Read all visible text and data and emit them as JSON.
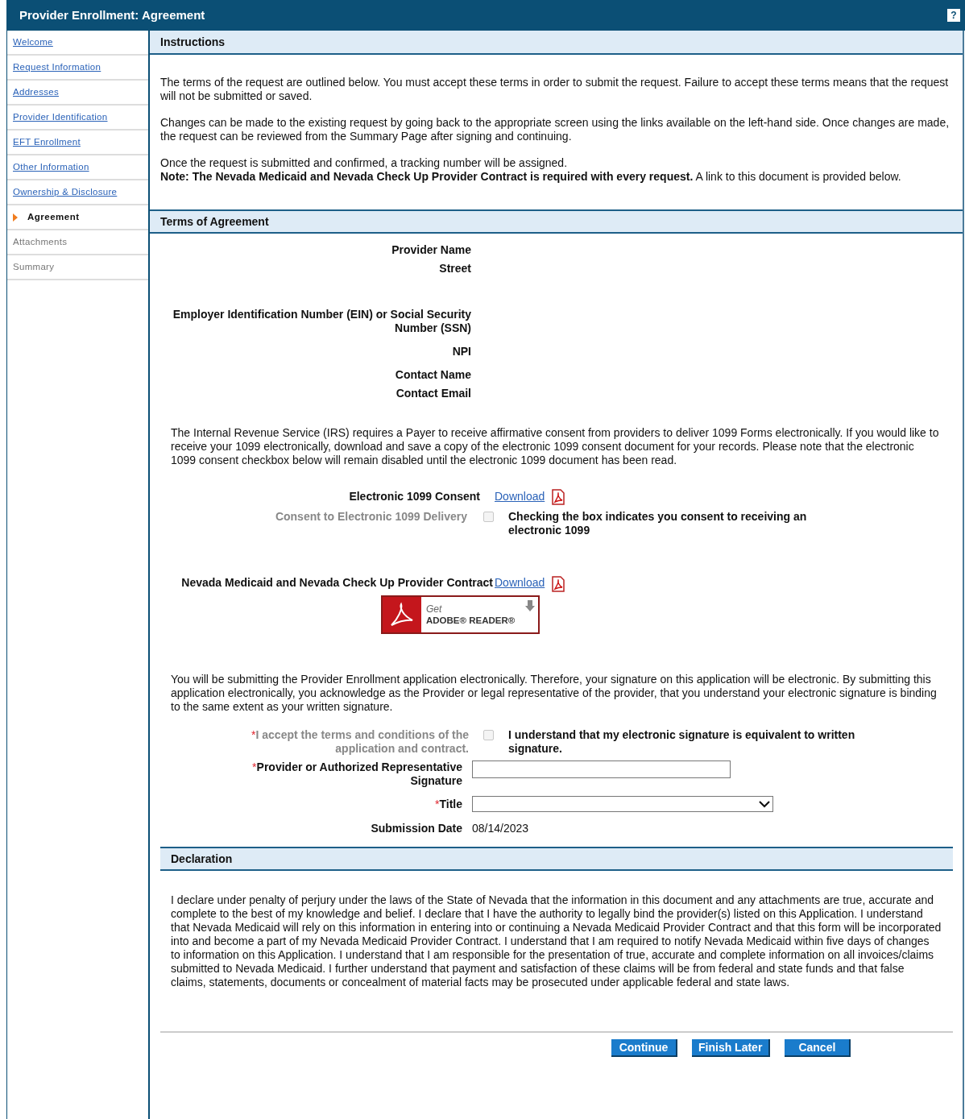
{
  "window": {
    "title": "Provider Enrollment: Agreement",
    "help": "?"
  },
  "sidebar": {
    "items": [
      {
        "label": "Welcome",
        "kind": "link",
        "selected": false
      },
      {
        "label": "Request Information",
        "kind": "link",
        "selected": false
      },
      {
        "label": "Addresses",
        "kind": "link",
        "selected": false
      },
      {
        "label": "Provider Identification",
        "kind": "link",
        "selected": false
      },
      {
        "label": "EFT Enrollment",
        "kind": "link",
        "selected": false
      },
      {
        "label": "Other Information",
        "kind": "link",
        "selected": false
      },
      {
        "label": "Ownership & Disclosure",
        "kind": "link",
        "selected": false
      },
      {
        "label": "Agreement",
        "kind": "link",
        "selected": true
      },
      {
        "label": "Attachments",
        "kind": "disabled",
        "selected": false
      },
      {
        "label": "Summary",
        "kind": "disabled",
        "selected": false
      }
    ]
  },
  "instructions": {
    "title": "Instructions",
    "paragraphs": [
      "The terms of the request are outlined below. You must accept these terms in order to submit the request. Failure to accept these terms means that the request will not be submitted or saved.",
      "Changes can be made to the existing request by going back to the appropriate screen using the links available on the left-hand side. Once changes are made, the request can be reviewed from the Summary Page after signing and continuing.",
      "Once the request is submitted and confirmed, a tracking number will be assigned.",
      "**Note: The Nevada Medicaid and Nevada Check Up Provider Contract is required with every request.** A link to this document is provided below."
    ]
  },
  "terms": {
    "title": "Terms of Agreement",
    "fields": [
      "Provider Name",
      "Street",
      "Employer Identification Number (EIN) or Social Security Number (SSN)",
      "NPI",
      "Contact Name",
      "Contact Email"
    ],
    "irs_notice": "The Internal Revenue Service (IRS) requires a Payer to receive affirmative consent from providers to deliver 1099 Forms electronically. If you would like to receive your 1099 electronically, download and save a copy of the electronic 1099 consent document for your records. Please note that the electronic 1099 consent checkbox below will remain disabled until the electronic 1099 document has been read.",
    "consent_doc": {
      "label": "Electronic 1099 Consent",
      "link": "Download"
    },
    "consent_delivery": {
      "label": "Consent to Electronic 1099 Delivery",
      "checked": false,
      "disabled": true,
      "text": "Checking the box indicates you consent to receiving an electronic 1099"
    },
    "contract_doc": {
      "label": "Nevada Medicaid and Nevada Check Up Provider Contract",
      "link": "Download"
    },
    "adobe": {
      "line1": "Get",
      "line2": "ADOBE® READER®"
    },
    "signature_notice": "You will be submitting the Provider Enrollment application electronically. Therefore, your signature on this application will be electronic. By submitting this application electronically, you acknowledge as the Provider or legal representative of the provider, that you understand your electronic signature is binding to the same extent as your written signature.",
    "accept": {
      "required": "*",
      "label": "I accept the terms and conditions of the application and contract.",
      "checked": false,
      "disabled": true,
      "text": "I understand that my electronic signature is equivalent to written signature."
    },
    "signature": {
      "required": "*",
      "label": "Provider or Authorized Representative Signature"
    },
    "title_field": {
      "required": "*",
      "label": "Title"
    },
    "submission_date": {
      "label": "Submission Date",
      "value": "08/14/2023"
    }
  },
  "declaration": {
    "title": "Declaration",
    "text": "I declare under penalty of perjury under the laws of the State of Nevada that the information in this document and any attachments are true, accurate and complete to the best of my knowledge and belief. I declare that I have the authority to legally bind the provider(s) listed on this Application. I understand that Nevada Medicaid will rely on this information in entering into or continuing a Nevada Medicaid Provider Contract and that this form will be incorporated into and become a part of my Nevada Medicaid Provider Contract. I understand that I am required to notify Nevada Medicaid within five days of changes to information on this Application. I understand that I am responsible for the presentation of true, accurate and complete information on all invoices/claims submitted to Nevada Medicaid. I further understand that payment and satisfaction of these claims will be from federal and state funds and that false claims, statements, documents or concealment of material facts may be prosecuted under applicable federal and state laws."
  },
  "buttons": [
    "Continue",
    "Finish Later",
    "Cancel"
  ]
}
